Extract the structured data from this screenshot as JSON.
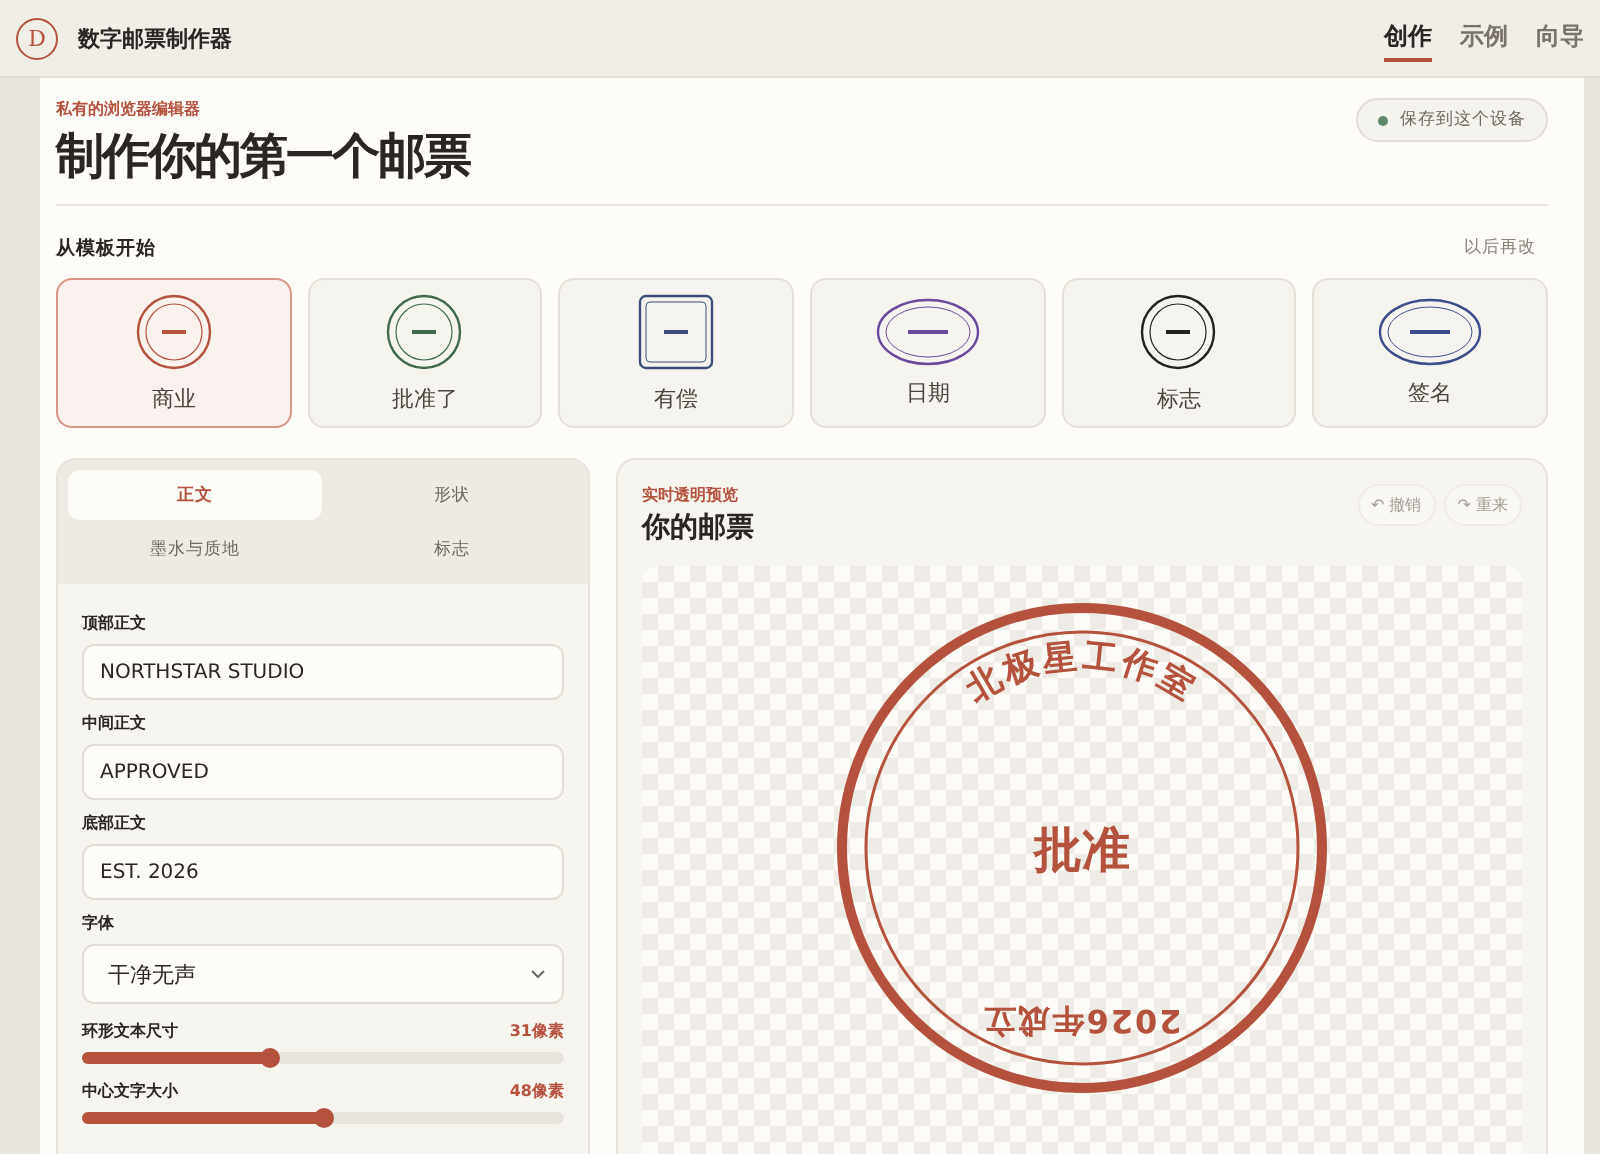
{
  "app": {
    "logo_letter": "D",
    "title": "数字邮票制作器"
  },
  "nav": [
    {
      "label": "创作",
      "selected": true
    },
    {
      "label": "示例",
      "selected": false
    },
    {
      "label": "向导",
      "selected": false
    }
  ],
  "header": {
    "eyebrow": "私有的浏览器编辑器",
    "title": "制作你的第一个邮票",
    "save_status": "保存到这个设备"
  },
  "templates_section": {
    "title": "从模板开始",
    "action": "以后再改"
  },
  "templates": [
    {
      "label": "商业",
      "kind": "circle",
      "color": "#b5523e",
      "selected": true
    },
    {
      "label": "批准了",
      "kind": "circle",
      "color": "#3f6b4c",
      "selected": false
    },
    {
      "label": "有偿",
      "kind": "square",
      "color": "#3c4d7a",
      "selected": false
    },
    {
      "label": "日期",
      "kind": "oval",
      "color": "#6a4a9a",
      "selected": false
    },
    {
      "label": "标志",
      "kind": "circle",
      "color": "#222222",
      "selected": false
    },
    {
      "label": "签名",
      "kind": "oval",
      "color": "#3c4d8a",
      "selected": false
    }
  ],
  "editor_tabs": [
    {
      "label": "正文",
      "selected": true
    },
    {
      "label": "形状",
      "selected": false
    },
    {
      "label": "墨水与质地",
      "selected": false
    },
    {
      "label": "标志",
      "selected": false
    }
  ],
  "fields": [
    {
      "label": "顶部正文",
      "value": "NORTHSTAR STUDIO"
    },
    {
      "label": "中间正文",
      "value": "APPROVED"
    },
    {
      "label": "底部正文",
      "value": "EST. 2026"
    }
  ],
  "font": {
    "label": "字体",
    "value": "干净无声"
  },
  "sliders": [
    {
      "label": "环形文本尺寸",
      "reading": "31像素",
      "level": 0.39
    },
    {
      "label": "中心文字大小",
      "reading": "48像素",
      "level": 0.5
    }
  ],
  "preview": {
    "eyebrow": "实时透明预览",
    "title": "你的邮票",
    "undo": "↶ 撤销",
    "redo": "↷ 重来"
  },
  "stamp": {
    "top_text": "北极星工作室",
    "center_text": "批准",
    "bottom_text": "2026年成立",
    "color": "#b5523e"
  }
}
